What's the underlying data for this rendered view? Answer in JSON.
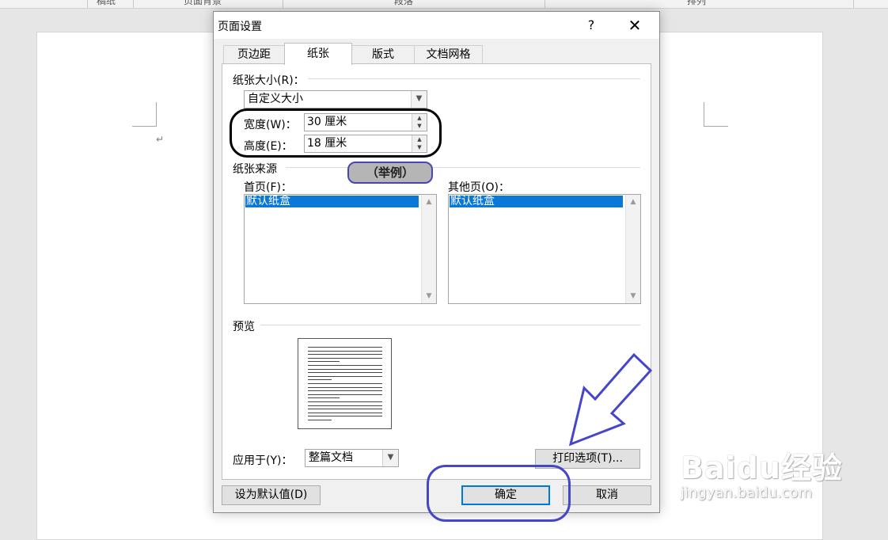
{
  "ribbon": {
    "groups": [
      "稿纸",
      "页面背景",
      "段落",
      "排列"
    ]
  },
  "dialog": {
    "title": "页面设置",
    "help_label": "?",
    "close_label": "✕",
    "tabs": [
      {
        "label": "页边距",
        "active": false
      },
      {
        "label": "纸张",
        "active": true
      },
      {
        "label": "版式",
        "active": false
      },
      {
        "label": "文档网格",
        "active": false
      }
    ],
    "paper_size": {
      "section_label": "纸张大小(R)：",
      "selected": "自定义大小",
      "width_label": "宽度(W)：",
      "width_value": "30 厘米",
      "height_label": "高度(E)：",
      "height_value": "18 厘米"
    },
    "paper_source": {
      "section_label": "纸张来源",
      "first_page_label": "首页(F)：",
      "first_page_selected": "默认纸盒",
      "other_pages_label": "其他页(O)：",
      "other_pages_selected": "默认纸盒"
    },
    "preview": {
      "section_label": "预览"
    },
    "apply_to": {
      "label": "应用于(Y)：",
      "selected": "整篇文档"
    },
    "print_options_label": "打印选项(T)...",
    "set_default_label": "设为默认值(D)",
    "ok_label": "确定",
    "cancel_label": "取消"
  },
  "annotations": {
    "example_label": "（举例）",
    "outline_color": "#000000",
    "accent_color": "#4646c8"
  },
  "watermark": {
    "main": "Baidu经验",
    "sub": "jingyan.baidu.com"
  },
  "colors": {
    "selection": "#0a78d7",
    "dialog_bg": "#f0f0f0",
    "page_bg": "#ffffff",
    "desktop_bg": "#e6e6e6"
  }
}
